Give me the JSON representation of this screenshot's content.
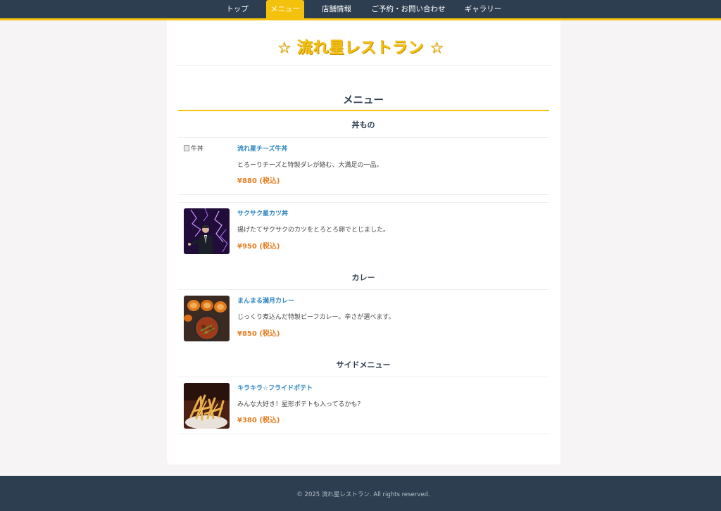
{
  "nav": {
    "items": [
      {
        "label": "トップ",
        "active": false
      },
      {
        "label": "メニュー",
        "active": true
      },
      {
        "label": "店舗情報",
        "active": false
      },
      {
        "label": "ご予約・お問い合わせ",
        "active": false
      },
      {
        "label": "ギャラリー",
        "active": false
      }
    ]
  },
  "header": {
    "title": "☆ 流れ星レストラン ☆"
  },
  "menu": {
    "heading": "メニュー",
    "categories": [
      {
        "name": "丼もの",
        "items": [
          {
            "image_alt": "牛丼",
            "name": "流れ星チーズ牛丼",
            "description": "とろーりチーズと特製ダレが絡む、大満足の一品。",
            "price": "¥880 (税込)"
          },
          {
            "image": "dark-figure-purple-lightning",
            "name": "サクサク星カツ丼",
            "description": "揚げたてサクサクのカツをとろとろ卵でとじました。",
            "price": "¥950 (税込)"
          }
        ]
      },
      {
        "name": "カレー",
        "items": [
          {
            "image": "curry-with-pumpkin",
            "name": "まんまる満月カレー",
            "description": "じっくり煮込んだ特製ビーフカレー。辛さが選べます。",
            "price": "¥850 (税込)"
          }
        ]
      },
      {
        "name": "サイドメニュー",
        "items": [
          {
            "image": "french-fries",
            "name": "キラキラ☆フライドポテト",
            "description": "みんな大好き！星形ポテトも入ってるかも？",
            "price": "¥380 (税込)"
          }
        ]
      }
    ]
  },
  "footer": {
    "copyright": "© 2025 流れ星レストラン. All rights reserved."
  },
  "colors": {
    "navbar": "#2c3e50",
    "accent": "#f4c20d",
    "link": "#2e86c1",
    "price": "#e67e22"
  }
}
